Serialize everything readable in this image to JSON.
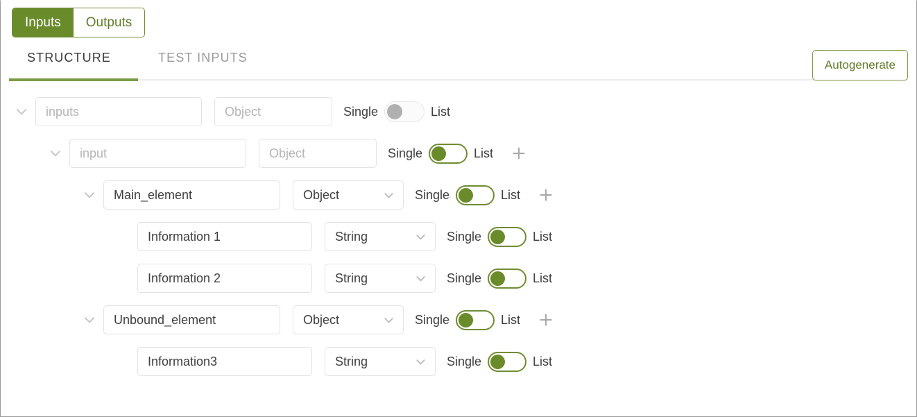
{
  "segmented": {
    "tabs": [
      {
        "label": "Inputs",
        "active": true
      },
      {
        "label": "Outputs",
        "active": false
      }
    ]
  },
  "subtabs": [
    {
      "label": "STRUCTURE",
      "active": true
    },
    {
      "label": "TEST INPUTS",
      "active": false
    }
  ],
  "autogenerate": {
    "label": "Autogenerate"
  },
  "toggle_labels": {
    "single": "Single",
    "list": "List"
  },
  "colors": {
    "brand_green": "#6a8b2a",
    "brand_green_border": "#6f8c34",
    "underline_green": "#7a9c46",
    "field_border": "#e2e2e2",
    "placeholder_text": "#b4b4b4",
    "value_text": "#3f3f3f",
    "muted_text": "#9a9a9a",
    "toggle_disabled_knob": "#b0b0b0",
    "plus_icon": "#a8a8a8",
    "chevron_icon": "#c9c9c9"
  },
  "tree": {
    "rows": [
      {
        "indent": 0,
        "expanded": true,
        "has_chevron": true,
        "name": "inputs",
        "name_is_placeholder": true,
        "name_width": 240,
        "type": "Object",
        "type_is_placeholder": true,
        "type_has_chevron": false,
        "type_width": 170,
        "toggle_position": "single",
        "toggle_disabled": true,
        "has_add": false
      },
      {
        "indent": 1,
        "expanded": true,
        "has_chevron": true,
        "name": "input",
        "name_is_placeholder": true,
        "name_width": 255,
        "type": "Object",
        "type_is_placeholder": true,
        "type_has_chevron": false,
        "type_width": 170,
        "toggle_position": "single",
        "toggle_disabled": false,
        "has_add": true
      },
      {
        "indent": 2,
        "expanded": true,
        "has_chevron": true,
        "name": "Main_element",
        "name_is_placeholder": false,
        "name_width": 255,
        "type": "Object",
        "type_is_placeholder": false,
        "type_has_chevron": true,
        "type_width": 160,
        "toggle_position": "single",
        "toggle_disabled": false,
        "has_add": true
      },
      {
        "indent": 3,
        "expanded": false,
        "has_chevron": false,
        "name": "Information 1",
        "name_is_placeholder": false,
        "name_width": 252,
        "type": "String",
        "type_is_placeholder": false,
        "type_has_chevron": true,
        "type_width": 160,
        "toggle_position": "single",
        "toggle_disabled": false,
        "has_add": false
      },
      {
        "indent": 3,
        "expanded": false,
        "has_chevron": false,
        "name": "Information 2",
        "name_is_placeholder": false,
        "name_width": 252,
        "type": "String",
        "type_is_placeholder": false,
        "type_has_chevron": true,
        "type_width": 160,
        "toggle_position": "single",
        "toggle_disabled": false,
        "has_add": false
      },
      {
        "indent": 2,
        "expanded": true,
        "has_chevron": true,
        "name": "Unbound_element",
        "name_is_placeholder": false,
        "name_width": 255,
        "type": "Object",
        "type_is_placeholder": false,
        "type_has_chevron": true,
        "type_width": 160,
        "toggle_position": "single",
        "toggle_disabled": false,
        "has_add": true
      },
      {
        "indent": 3,
        "expanded": false,
        "has_chevron": false,
        "name": "Information3",
        "name_is_placeholder": false,
        "name_width": 252,
        "type": "String",
        "type_is_placeholder": false,
        "type_has_chevron": true,
        "type_width": 160,
        "toggle_position": "single",
        "toggle_disabled": false,
        "has_add": false
      }
    ]
  }
}
